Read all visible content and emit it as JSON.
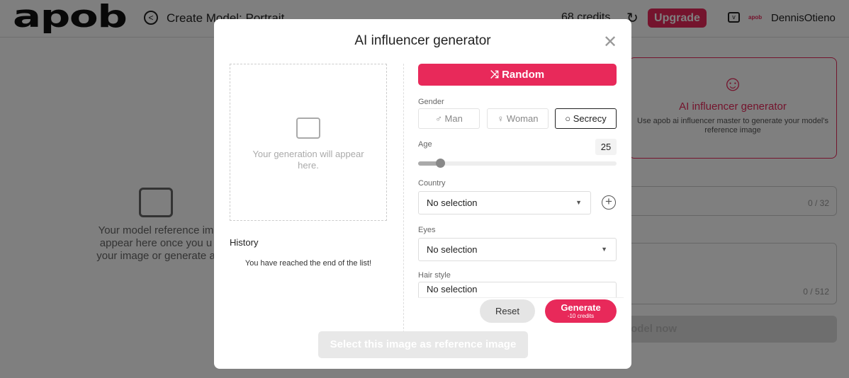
{
  "header": {
    "logo": "apob",
    "title": "Create Model: Portrait",
    "credits": "68 credits",
    "upgrade": "Upgrade",
    "mini_logo": "apob",
    "username": "DennisOtieno"
  },
  "background": {
    "placeholder": [
      "Your model reference im",
      "appear here once you u",
      "your image or generate a"
    ],
    "card": {
      "title": "AI influencer generator",
      "description": "Use apob ai influencer master to generate your model's reference image"
    },
    "name_counter": "0 / 32",
    "desc_counter": "0 / 512",
    "create_button": "Create model now"
  },
  "modal": {
    "title": "AI influencer generator",
    "preview_text": "Your generation will appear here.",
    "history_label": "History",
    "history_end": "You have reached the end of the list!",
    "random": "Random",
    "gender": {
      "label": "Gender",
      "options": [
        "Man",
        "Woman",
        "Secrecy"
      ],
      "selected": "Secrecy"
    },
    "age": {
      "label": "Age",
      "value": "25",
      "slider_fraction": 0.11
    },
    "country": {
      "label": "Country",
      "value": "No selection"
    },
    "eyes": {
      "label": "Eyes",
      "value": "No selection"
    },
    "hair": {
      "label": "Hair style",
      "value": "No selection"
    },
    "reset": "Reset",
    "generate": "Generate",
    "generate_cost": "-10 credits",
    "select_ref": "Select this image as reference image"
  },
  "colors": {
    "accent": "#e8295a"
  }
}
